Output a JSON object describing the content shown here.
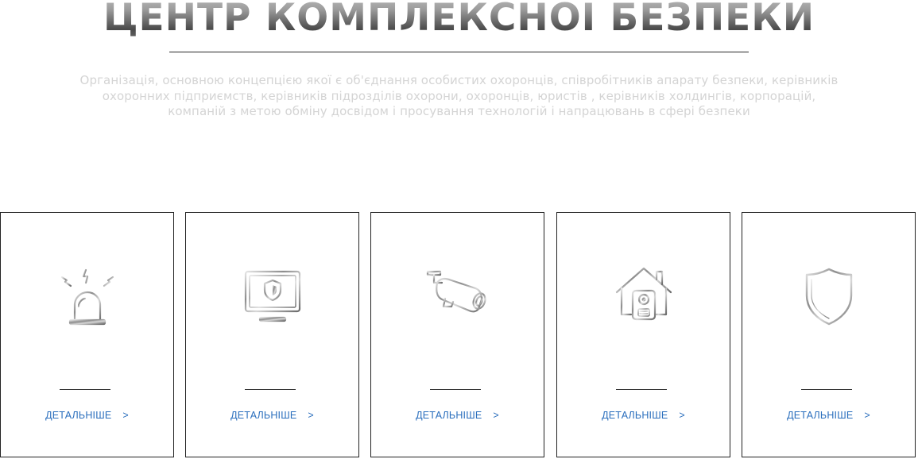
{
  "header": {
    "title": "ЦЕНТР КОМПЛЕКСНОЇ БЕЗПЕКИ",
    "description": "Організація, основною концепцією якої є об'єднання особистих охоронців, співробітників апарату безпеки, керівників охоронних підприємств, керівників підрозділів охорони, охоронців, юристів , керівників холдингів, корпорацій, компаній з метою обміну досвідом і просування технологій і напрацювань в сфері безпеки"
  },
  "cards": [
    {
      "icon": "alarm-siren-icon",
      "link_label": "ДЕТАЛЬНІШЕ",
      "arrow": ">"
    },
    {
      "icon": "monitor-shield-icon",
      "link_label": "ДЕТАЛЬНІШЕ",
      "arrow": ">"
    },
    {
      "icon": "security-camera-icon",
      "link_label": "ДЕТАЛЬНІШЕ",
      "arrow": ">"
    },
    {
      "icon": "home-intercom-icon",
      "link_label": "ДЕТАЛЬНІШЕ",
      "arrow": ">"
    },
    {
      "icon": "shield-icon",
      "link_label": "ДЕТАЛЬНІШЕ",
      "arrow": ">"
    }
  ],
  "colors": {
    "link": "#2a6ebd",
    "description": "#d4d4d4",
    "border": "#222222"
  }
}
